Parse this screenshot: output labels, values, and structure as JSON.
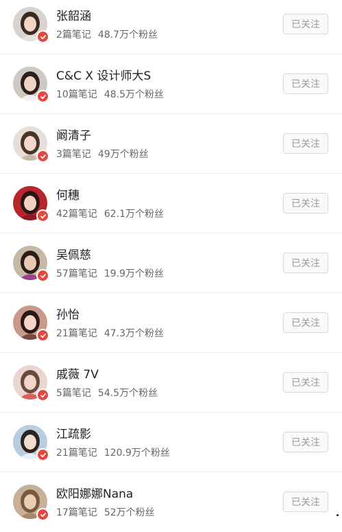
{
  "follow_label": "已关注",
  "accent": "#e8453c",
  "users": [
    {
      "name": "张韶涵",
      "notes": "2篇笔记",
      "fans": "48.7万个粉丝",
      "bg": "#d9d3cf",
      "hair": "#3a2a24",
      "skin": "#f1d6c6",
      "top": "#e8e2dd"
    },
    {
      "name": "C&C X 设计师大S",
      "notes": "10篇笔记",
      "fans": "48.5万个粉丝",
      "bg": "#cfc9c3",
      "hair": "#2b201b",
      "skin": "#efd3c2",
      "top": "#f3f1ee"
    },
    {
      "name": "阚清子",
      "notes": "3篇笔记",
      "fans": "49万个粉丝",
      "bg": "#e6dfd8",
      "hair": "#4a342a",
      "skin": "#f3d9cb",
      "top": "#c9b8a8"
    },
    {
      "name": "何穗",
      "notes": "42篇笔记",
      "fans": "62.1万个粉丝",
      "bg": "#b8242c",
      "hair": "#2a1614",
      "skin": "#f2cfc0",
      "top": "#8d1a20"
    },
    {
      "name": "吴佩慈",
      "notes": "57篇笔记",
      "fans": "19.9万个粉丝",
      "bg": "#c8b9a6",
      "hair": "#2a1e18",
      "skin": "#e9c9b5",
      "top": "#a0418c"
    },
    {
      "name": "孙怡",
      "notes": "21篇笔记",
      "fans": "47.3万个粉丝",
      "bg": "#c99a8c",
      "hair": "#2a1a16",
      "skin": "#f3d4c6",
      "top": "#7a4a3e"
    },
    {
      "name": "戚薇 7V",
      "notes": "5篇笔记",
      "fans": "54.5万个粉丝",
      "bg": "#e9d6cf",
      "hair": "#6a4a3c",
      "skin": "#f1d5c8",
      "top": "#d8615a"
    },
    {
      "name": "江疏影",
      "notes": "21篇笔记",
      "fans": "120.9万个粉丝",
      "bg": "#b9cde0",
      "hair": "#2b2420",
      "skin": "#f2dbd0",
      "top": "#e8eef4"
    },
    {
      "name": "欧阳娜娜Nana",
      "notes": "17篇笔记",
      "fans": "52万个粉丝",
      "bg": "#c6b098",
      "hair": "#7a5a3c",
      "skin": "#e9cdb4",
      "top": "#a88a6a"
    }
  ]
}
